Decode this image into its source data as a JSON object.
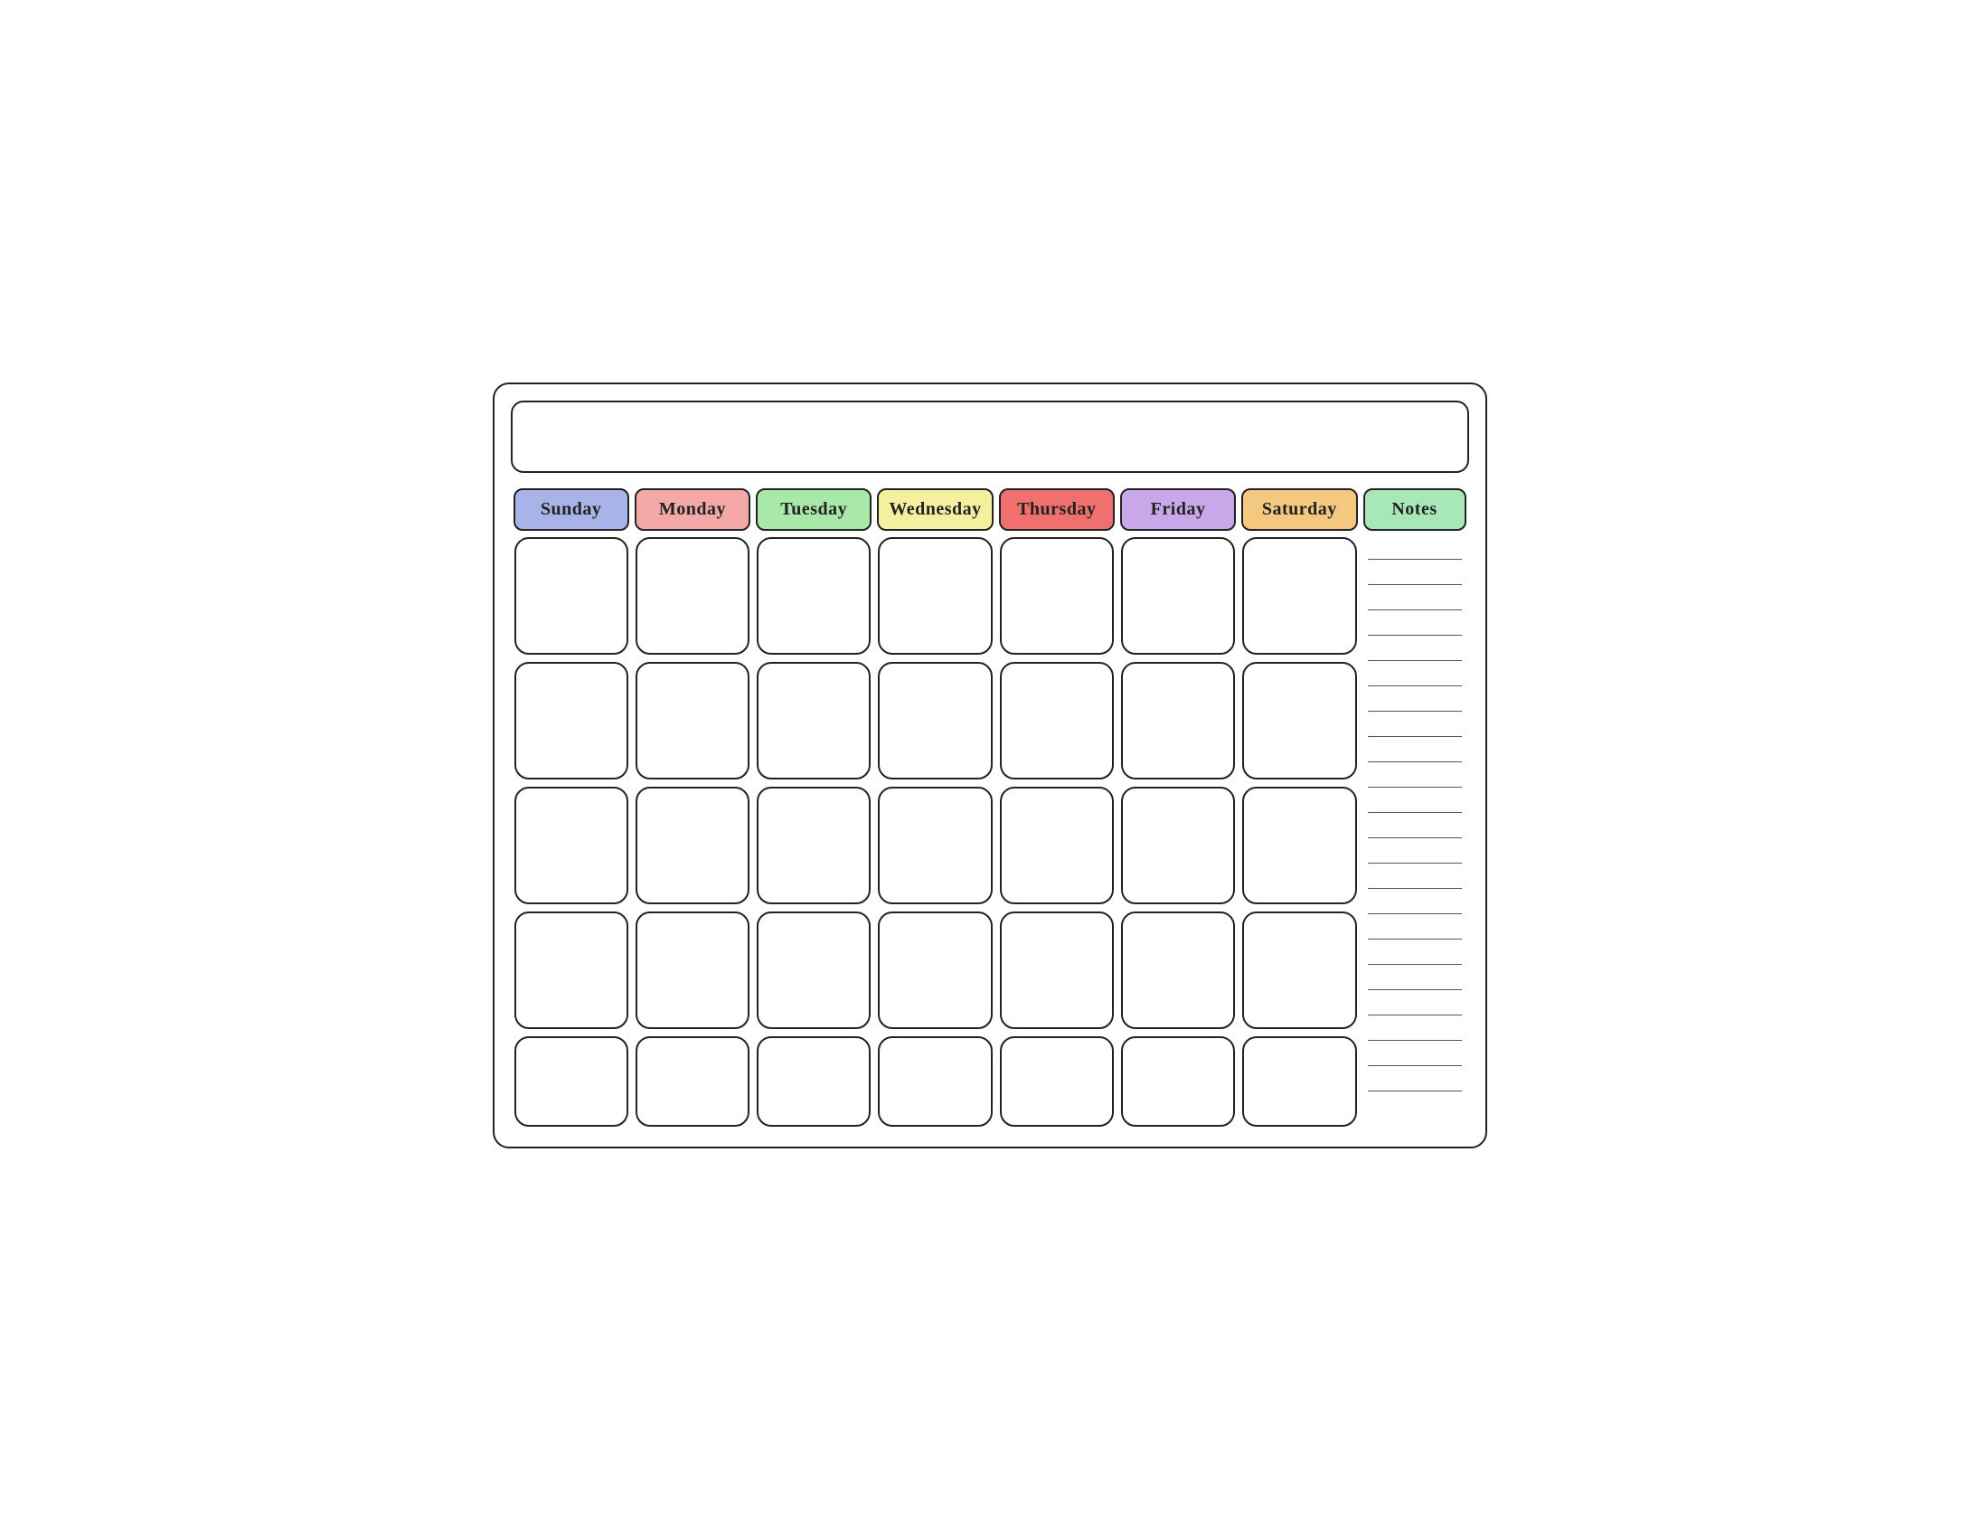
{
  "header": {
    "title": ""
  },
  "days": {
    "sunday": "Sunday",
    "monday": "Monday",
    "tuesday": "Tuesday",
    "wednesday": "Wednesday",
    "thursday": "Thursday",
    "friday": "Friday",
    "saturday": "Saturday",
    "notes": "Notes"
  },
  "colors": {
    "sunday": "#a8b4e8",
    "monday": "#f5a8a8",
    "tuesday": "#a8e8a8",
    "wednesday": "#f5f0a0",
    "thursday": "#f07070",
    "friday": "#c8a8e8",
    "saturday": "#f5c880",
    "notes": "#a8e8b8"
  },
  "rows": 5,
  "notes_lines": 22
}
